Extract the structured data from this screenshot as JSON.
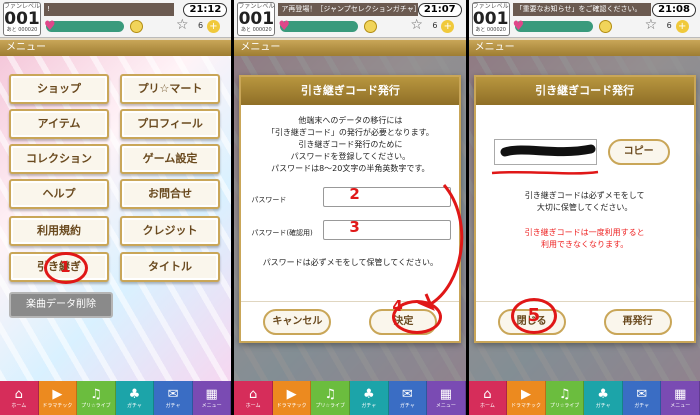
{
  "panels": [
    {
      "news": "!",
      "time": "21:12",
      "counter": "6"
    },
    {
      "news": "ア再登場！［ジャンプセレクションガチャ］開催",
      "time": "21:07",
      "counter": "6"
    },
    {
      "news": "「重要なお知らせ」をご確認ください。",
      "time": "21:08",
      "counter": "6"
    }
  ],
  "header": {
    "level_label": "ファンレベル",
    "level": "001",
    "level_sub": "あと 000020"
  },
  "section_title": "メニュー",
  "menu": {
    "items": [
      "ショップ",
      "プリ☆マート",
      "アイテム",
      "プロフィール",
      "コレクション",
      "ゲーム設定",
      "ヘルプ",
      "お問合せ",
      "利用規約",
      "クレジット",
      "引き継ぎ",
      "タイトル"
    ],
    "danger": "楽曲データ削除"
  },
  "dialog": {
    "title": "引き継ぎコード発行",
    "intro": [
      "他端末へのデータの移行には",
      "「引き継ぎコード」の発行が必要となります。",
      "引き継ぎコード発行のために",
      "パスワードを登録してください。",
      "パスワードは8〜20文字の半角英数字です。"
    ],
    "password_label": "パスワード",
    "password_confirm_label": "パスワード(確認用)",
    "note": "パスワードは必ずメモをして保管してください。",
    "cancel": "キャンセル",
    "ok": "決定"
  },
  "dialog2": {
    "title": "引き継ぎコード発行",
    "copy": "コピー",
    "msg": [
      "引き継ぎコードは必ずメモをして",
      "大切に保管してください。"
    ],
    "warn": [
      "引き継ぎコードは一度利用すると",
      "利用できなくなります。"
    ],
    "close": "閉じる",
    "reissue": "再発行"
  },
  "nav": [
    "ホーム",
    "ドラマチック",
    "プリ☆ライブ",
    "ガチャ",
    "ガチャ",
    "メニュー"
  ],
  "annotations": [
    "1",
    "2",
    "3",
    "4",
    "5"
  ],
  "colors": {
    "accent": "#c9a658",
    "annotation": "#e01717"
  }
}
